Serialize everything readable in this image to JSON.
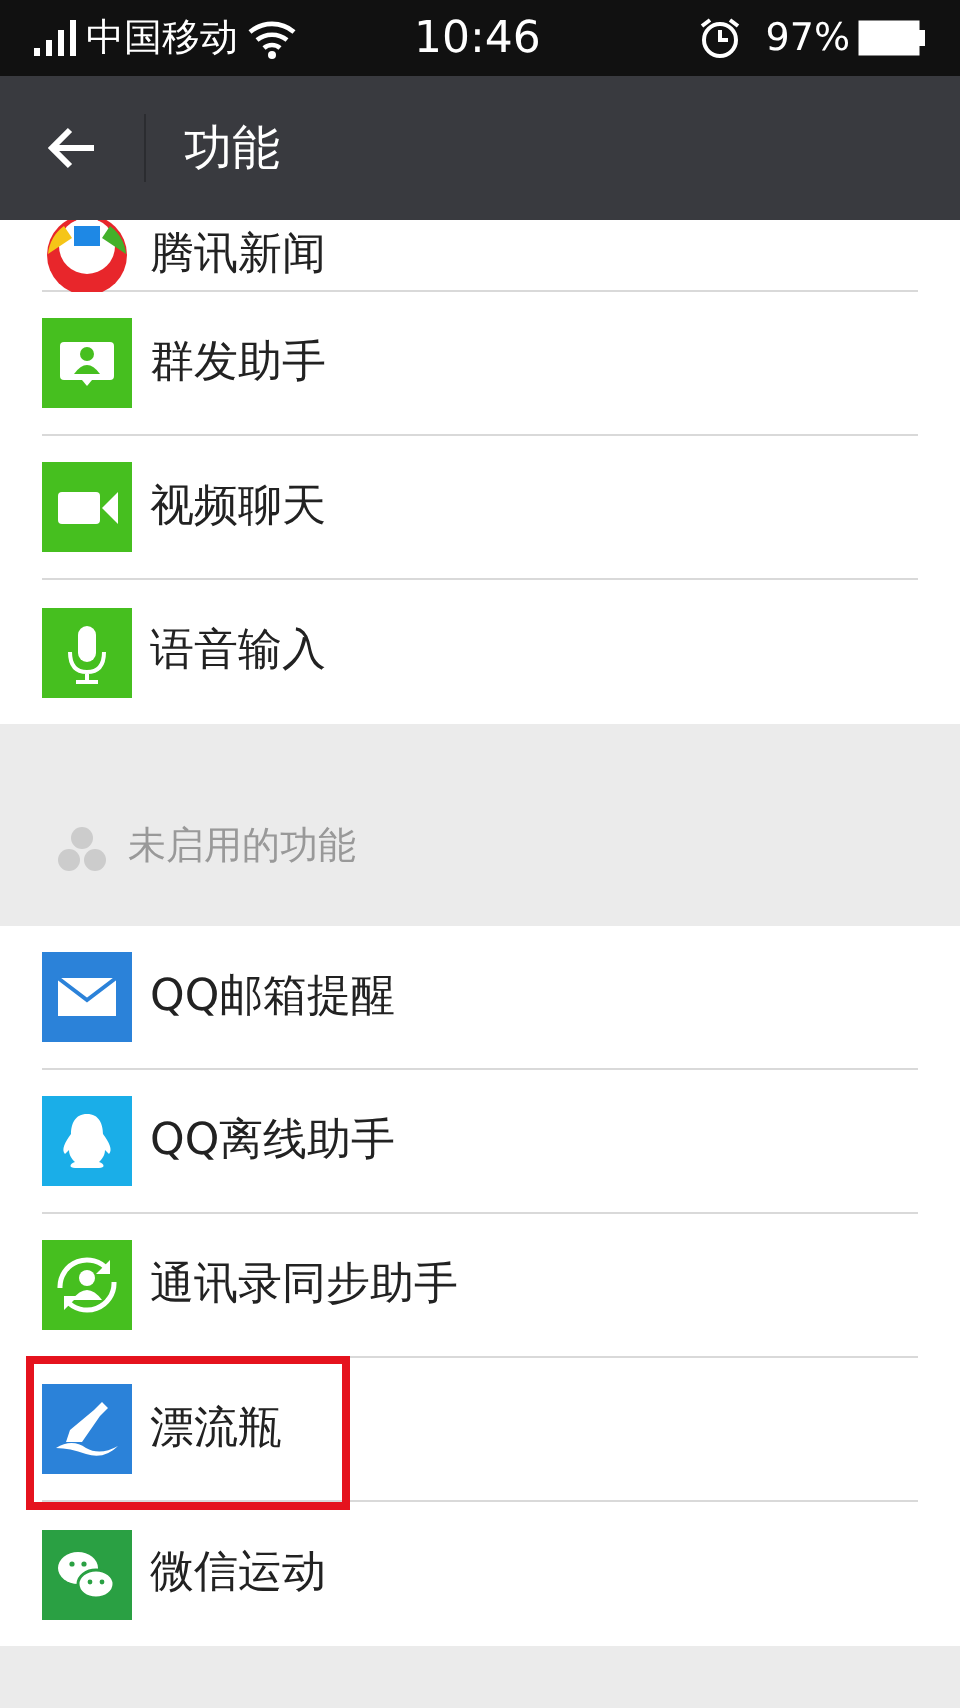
{
  "status_bar": {
    "carrier": "中国移动",
    "time": "10:46",
    "battery": "97%"
  },
  "header": {
    "title": "功能"
  },
  "enabled_items": [
    {
      "label": "腾讯新闻",
      "highlighted": false
    },
    {
      "label": "群发助手",
      "highlighted": false
    },
    {
      "label": "视频聊天",
      "highlighted": false
    },
    {
      "label": "语音输入",
      "highlighted": false
    }
  ],
  "disabled_section": {
    "title": "未启用的功能"
  },
  "disabled_items": [
    {
      "label": "QQ邮箱提醒",
      "highlighted": false
    },
    {
      "label": "QQ离线助手",
      "highlighted": false
    },
    {
      "label": "通讯录同步助手",
      "highlighted": false
    },
    {
      "label": "漂流瓶",
      "highlighted": true
    },
    {
      "label": "微信运动",
      "highlighted": false
    }
  ]
}
